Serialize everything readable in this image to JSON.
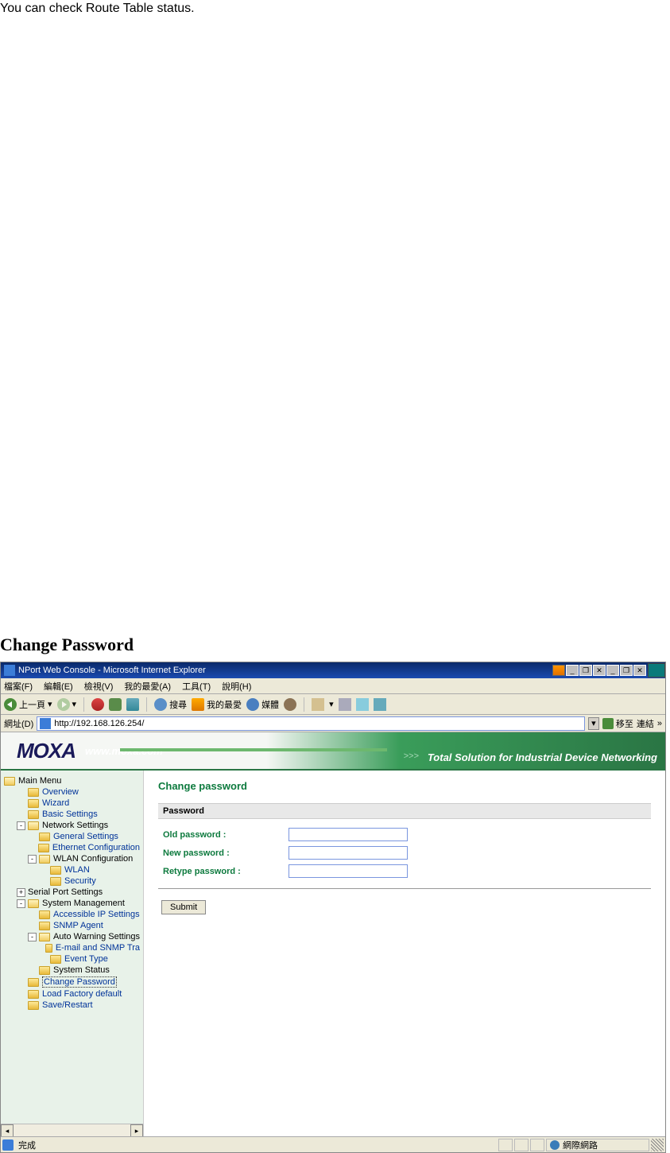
{
  "doc": {
    "intro_text": "You can check Route Table status.",
    "section_heading": "Change Password"
  },
  "titlebar": {
    "title": "NPort Web Console - Microsoft Internet Explorer"
  },
  "menubar": {
    "items": [
      "檔案(F)",
      "編輯(E)",
      "檢視(V)",
      "我的最愛(A)",
      "工具(T)",
      "說明(H)"
    ]
  },
  "toolbar": {
    "back": "上一頁",
    "search": "搜尋",
    "favorites": "我的最愛",
    "media": "媒體"
  },
  "addressbar": {
    "label": "網址(D)",
    "url": "http://192.168.126.254/",
    "go": "移至",
    "links": "連結"
  },
  "banner": {
    "logo": "MOXA",
    "url": "www.moxa.com",
    "slogan": "Total Solution for Industrial Device Networking",
    "arrows": ">>>"
  },
  "sidebar": {
    "main_menu": "Main Menu",
    "items": [
      {
        "label": "Overview",
        "indent": 1,
        "link": true
      },
      {
        "label": "Wizard",
        "indent": 1,
        "link": true
      },
      {
        "label": "Basic Settings",
        "indent": 1,
        "link": true
      },
      {
        "label": "Network Settings",
        "indent": 1,
        "toggle": "-",
        "text": true,
        "open": true
      },
      {
        "label": "General Settings",
        "indent": 2,
        "link": true
      },
      {
        "label": "Ethernet Configuration",
        "indent": 2,
        "link": true
      },
      {
        "label": "WLAN Configuration",
        "indent": 2,
        "toggle": "-",
        "text": true,
        "open": true
      },
      {
        "label": "WLAN",
        "indent": 3,
        "link": true
      },
      {
        "label": "Security",
        "indent": 3,
        "link": true
      },
      {
        "label": "Serial Port Settings",
        "indent": 1,
        "toggle": "+",
        "text": true,
        "noicon": true
      },
      {
        "label": "System Management",
        "indent": 1,
        "toggle": "-",
        "text": true,
        "open": true
      },
      {
        "label": "Accessible IP Settings",
        "indent": 2,
        "link": true
      },
      {
        "label": "SNMP Agent",
        "indent": 2,
        "link": true
      },
      {
        "label": "Auto Warning Settings",
        "indent": 2,
        "toggle": "-",
        "text": true,
        "open": true
      },
      {
        "label": "E-mail and SNMP Tra",
        "indent": 3,
        "link": true
      },
      {
        "label": "Event Type",
        "indent": 3,
        "link": true
      },
      {
        "label": "System Status",
        "indent": 2,
        "text": true
      },
      {
        "label": "Change Password",
        "indent": 1,
        "link": true,
        "active": true
      },
      {
        "label": "Load Factory default",
        "indent": 1,
        "link": true
      },
      {
        "label": "Save/Restart",
        "indent": 1,
        "link": true
      }
    ]
  },
  "panel": {
    "title": "Change password",
    "section": "Password",
    "old_label": "Old password :",
    "new_label": "New password :",
    "retype_label": "Retype password :",
    "submit": "Submit"
  },
  "statusbar": {
    "done": "完成",
    "zone": "網際網路"
  }
}
